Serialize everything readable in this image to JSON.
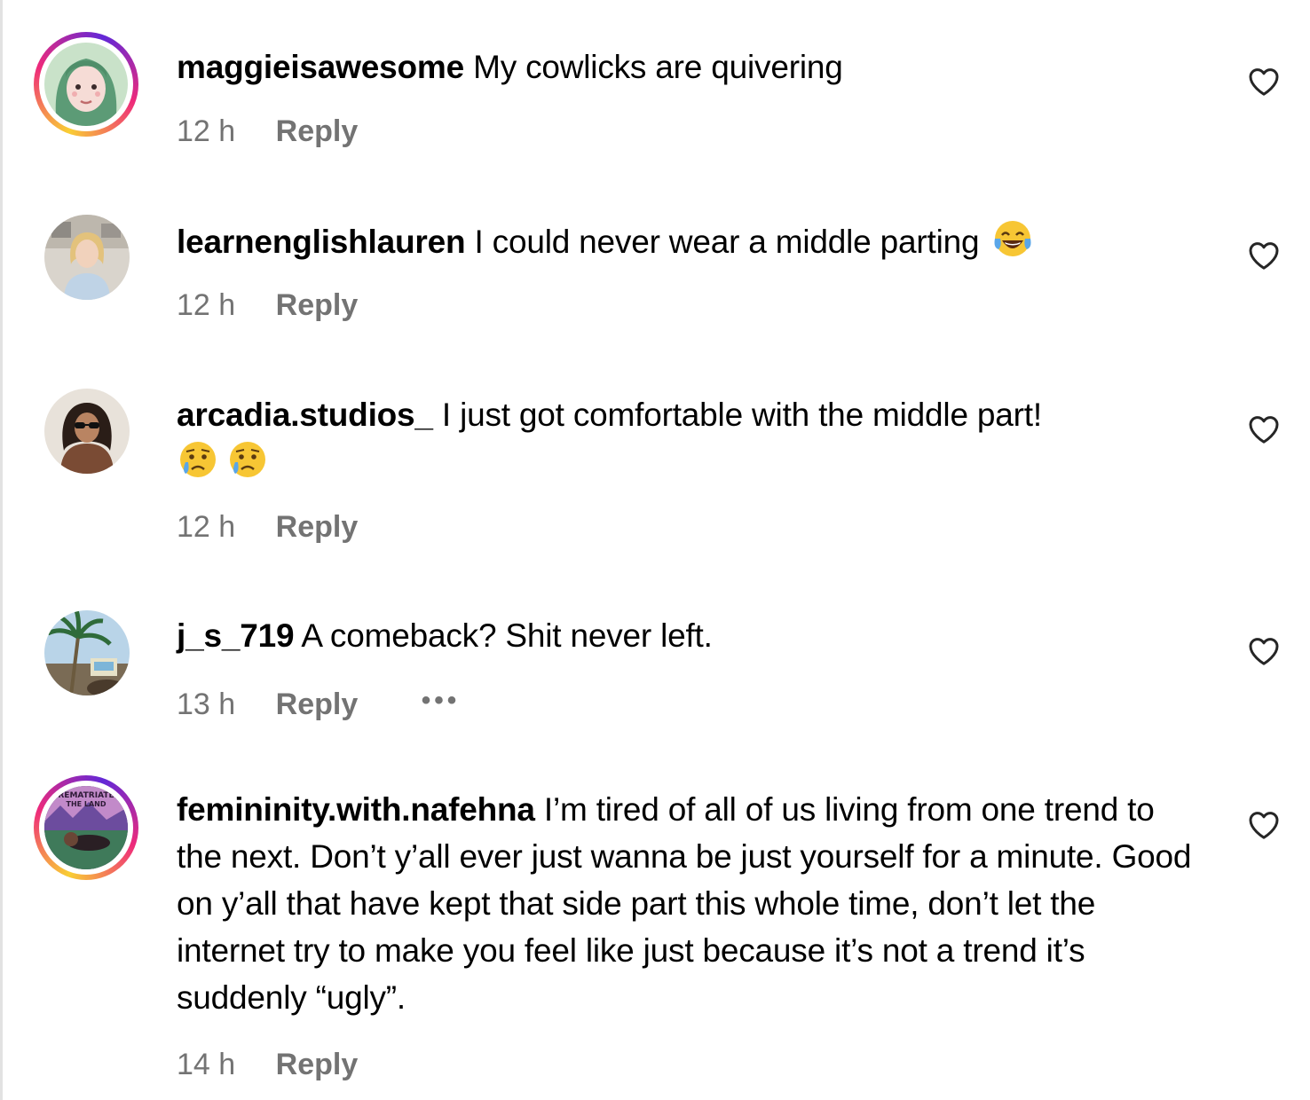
{
  "comments": [
    {
      "username": "maggieisawesome",
      "text": "My cowlicks are quivering",
      "time": "12 h",
      "reply_label": "Reply",
      "has_story_ring": true,
      "avatar_icon": "cartoon-woman-avatar"
    },
    {
      "username": "learnenglishlauren",
      "text": "I could never wear a middle parting",
      "emoji": "face-with-tears-of-joy-emoji",
      "time": "12 h",
      "reply_label": "Reply",
      "has_story_ring": false,
      "avatar_icon": "woman-photo-avatar"
    },
    {
      "username": "arcadia.studios_",
      "text": "I just got comfortable with the middle part!",
      "emoji": "crying-face-emoji x2",
      "time": "12 h",
      "reply_label": "Reply",
      "has_story_ring": false,
      "avatar_icon": "woman-sunglasses-avatar"
    },
    {
      "username": "j_s_719",
      "text": "A comeback? Shit never left.",
      "time": "13 h",
      "reply_label": "Reply",
      "more_label": "•••",
      "has_story_ring": false,
      "avatar_icon": "palm-tree-avatar"
    },
    {
      "username": "femininity.with.nafehna",
      "text": "I’m tired of all of us living from one trend to the next. Don’t y’all ever just wanna be just yourself for a minute. Good on y’all that have kept that side part this whole time, don’t let the internet try to make you feel like just because it’s not a trend it’s suddenly “ugly”.",
      "time": "14 h",
      "reply_label": "Reply",
      "has_story_ring": true,
      "avatar_icon": "rematriate-the-land-avatar",
      "avatar_text": "REMATRIATE THE LAND"
    }
  ],
  "colors": {
    "meta_text": "#737373",
    "text": "#000000",
    "background": "#ffffff"
  },
  "icons": {
    "like": "heart-outline-icon"
  }
}
